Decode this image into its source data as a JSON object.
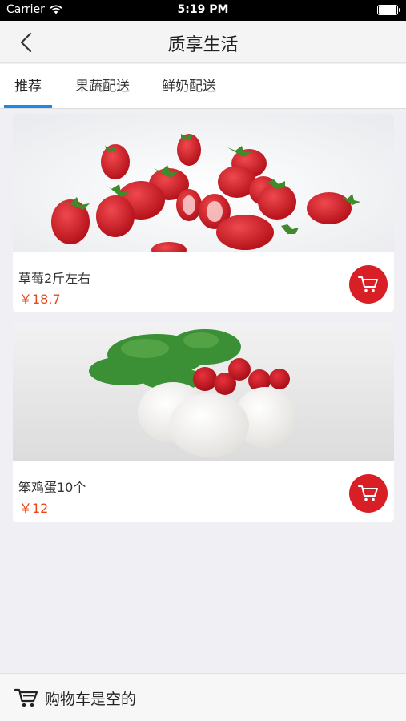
{
  "status_bar": {
    "carrier": "Carrier",
    "time": "5:19 PM"
  },
  "nav": {
    "title": "质享生活",
    "back_icon": "chevron-left-icon"
  },
  "tabs": [
    {
      "label": "推荐",
      "active": true
    },
    {
      "label": "果蔬配送",
      "active": false
    },
    {
      "label": "鲜奶配送",
      "active": false
    }
  ],
  "products": [
    {
      "name": "草莓2斤左右",
      "price": "￥18.7",
      "image": "strawberries-photo",
      "cart_icon": "shopping-cart-icon"
    },
    {
      "name": "笨鸡蛋10个",
      "price": "￥12",
      "image": "eggs-photo",
      "cart_icon": "shopping-cart-icon"
    }
  ],
  "bottom_bar": {
    "cart_icon": "shopping-cart-icon",
    "text": "购物车是空的"
  },
  "colors": {
    "accent": "#1e88e5",
    "cart_button": "#d81f26",
    "price": "#e8471c"
  }
}
